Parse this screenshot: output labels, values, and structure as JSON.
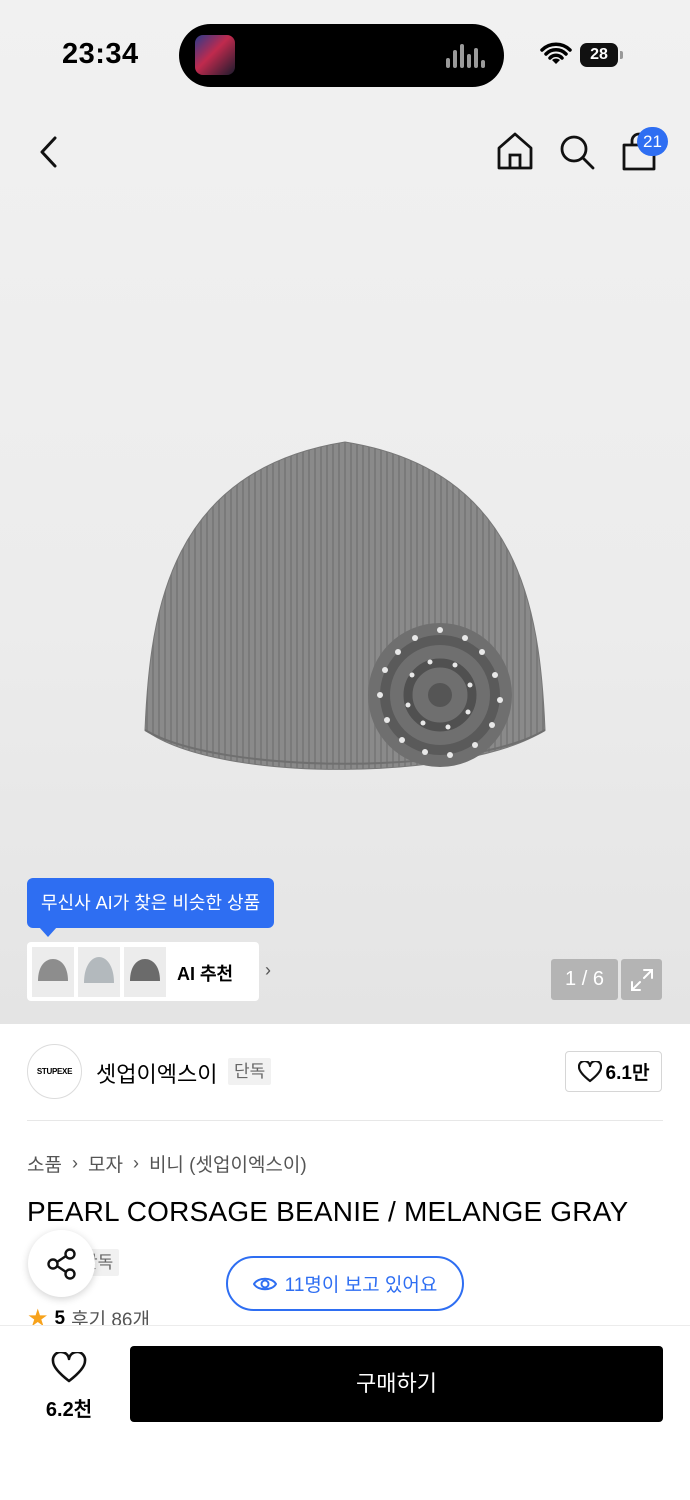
{
  "status_bar": {
    "time": "23:34",
    "battery": "28"
  },
  "nav": {
    "cart_count": "21",
    "icons": [
      "back-icon",
      "home-icon",
      "search-icon",
      "cart-icon"
    ]
  },
  "gallery": {
    "page_indicator": "1 / 6",
    "ai_tooltip": "무신사 AI가 찾은 비슷한 상품",
    "ai_label": "AI 추천"
  },
  "brand": {
    "name": "셋업이엑스이",
    "logo_text": "STUPEXE",
    "exclusive_tag": "단독",
    "likes": "6.1만"
  },
  "breadcrumb": [
    "소품",
    "모자",
    "비니 (셋업이엑스이)"
  ],
  "product": {
    "title": "PEARL CORSAGE BEANIE / MELANGE GRAY",
    "exclusive_tag": "단독",
    "viewing": "11명이 보고 있어요",
    "rating": "5",
    "reviews": "후기 86개"
  },
  "bottom_bar": {
    "like_count": "6.2천",
    "buy_label": "구매하기"
  },
  "colors": {
    "accent": "#2e6ef2",
    "star": "#f7a21b",
    "buy_bg": "#000000"
  }
}
